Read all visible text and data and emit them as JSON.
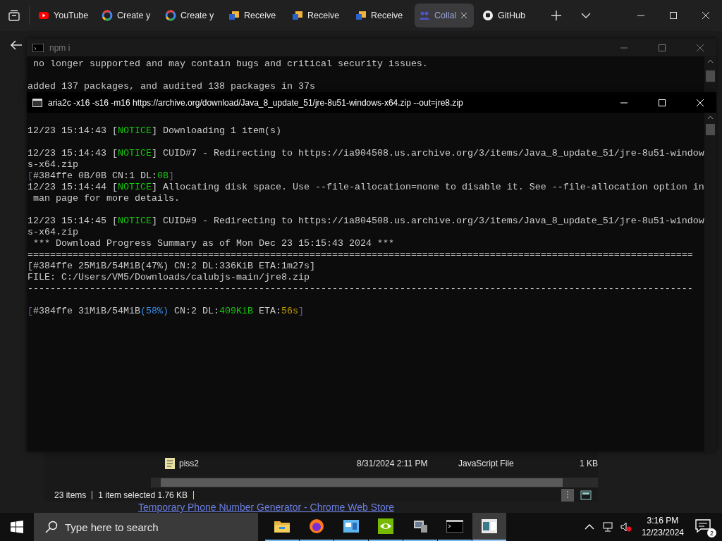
{
  "browser": {
    "tabs": [
      {
        "label": "YouTube",
        "kind": "video",
        "selected": false
      },
      {
        "label": "Create y",
        "kind": "search",
        "selected": false
      },
      {
        "label": "Create y",
        "kind": "search",
        "selected": false
      },
      {
        "label": "Receive",
        "kind": "mail",
        "selected": false
      },
      {
        "label": "Receive",
        "kind": "mail",
        "selected": false
      },
      {
        "label": "Receive",
        "kind": "mail",
        "selected": false
      },
      {
        "label": "Collal",
        "kind": "people",
        "selected": true
      },
      {
        "label": "GitHub",
        "kind": "code",
        "selected": false
      }
    ],
    "page_link": "Temporary Phone Number Generator - Chrome Web Store"
  },
  "npm_window": {
    "title": "npm i",
    "lines": [
      {
        "kind": "output",
        "segments": [
          {
            "kind": "text",
            "text": " no longer supported and may contain bugs and critical security issues."
          }
        ]
      },
      {
        "kind": "blank"
      },
      {
        "kind": "output",
        "segments": [
          {
            "kind": "text",
            "text": "added 137 packages, and audited 138 packages in 37s"
          }
        ]
      }
    ]
  },
  "aria_window": {
    "title": "aria2c  -x16 -s16 -m16 https://archive.org/download/Java_8_update_51/jre-8u51-windows-x64.zip --out=jre8.zip",
    "lines": [
      {
        "kind": "blank"
      },
      {
        "kind": "output",
        "segments": [
          {
            "kind": "text",
            "text": "12/23 15:14:43 ["
          },
          {
            "kind": "notice",
            "text": "NOTICE"
          },
          {
            "kind": "text",
            "text": "] Downloading 1 item(s)"
          }
        ]
      },
      {
        "kind": "blank"
      },
      {
        "kind": "output",
        "segments": [
          {
            "kind": "text",
            "text": "12/23 15:14:43 ["
          },
          {
            "kind": "notice",
            "text": "NOTICE"
          },
          {
            "kind": "text",
            "text": "] CUID#7 - Redirecting to https://ia904508.us.archive.org/3/items/Java_8_update_51/jre-8u51-window"
          }
        ]
      },
      {
        "kind": "output",
        "segments": [
          {
            "kind": "text",
            "text": "s-x64.zip"
          }
        ]
      },
      {
        "kind": "output",
        "segments": [
          {
            "kind": "dim",
            "text": "["
          },
          {
            "kind": "text",
            "text": "#384ffe 0B/0B CN:1 DL:"
          },
          {
            "kind": "notice",
            "text": "0B"
          },
          {
            "kind": "dim",
            "text": "]"
          }
        ]
      },
      {
        "kind": "output",
        "segments": [
          {
            "kind": "text",
            "text": "12/23 15:14:44 ["
          },
          {
            "kind": "notice",
            "text": "NOTICE"
          },
          {
            "kind": "text",
            "text": "] Allocating disk space. Use --file-allocation=none to disable it. See --file-allocation option in"
          }
        ]
      },
      {
        "kind": "output",
        "segments": [
          {
            "kind": "text",
            "text": " man page for more details."
          }
        ]
      },
      {
        "kind": "blank"
      },
      {
        "kind": "output",
        "segments": [
          {
            "kind": "text",
            "text": "12/23 15:14:45 ["
          },
          {
            "kind": "notice",
            "text": "NOTICE"
          },
          {
            "kind": "text",
            "text": "] CUID#9 - Redirecting to https://ia804508.us.archive.org/3/items/Java_8_update_51/jre-8u51-window"
          }
        ]
      },
      {
        "kind": "output",
        "segments": [
          {
            "kind": "text",
            "text": "s-x64.zip"
          }
        ]
      },
      {
        "kind": "output",
        "segments": [
          {
            "kind": "text",
            "text": " *** Download Progress Summary as of Mon Dec 23 15:15:43 2024 ***"
          }
        ]
      },
      {
        "kind": "output",
        "segments": [
          {
            "kind": "text",
            "text": "======================================================================================================================"
          }
        ]
      },
      {
        "kind": "output",
        "segments": [
          {
            "kind": "text",
            "text": "[#384ffe 25MiB/54MiB(47%) CN:2 DL:336KiB ETA:1m27s]"
          }
        ]
      },
      {
        "kind": "output",
        "segments": [
          {
            "kind": "text",
            "text": "FILE: C:/Users/VM5/Downloads/calubjs-main/jre8.zip"
          }
        ]
      },
      {
        "kind": "output",
        "segments": [
          {
            "kind": "text",
            "text": "----------------------------------------------------------------------------------------------------------------------"
          }
        ]
      },
      {
        "kind": "blank"
      },
      {
        "kind": "output",
        "segments": [
          {
            "kind": "dim",
            "text": "["
          },
          {
            "kind": "text",
            "text": "#384ffe 31MiB/54MiB"
          },
          {
            "kind": "percent",
            "text": "(58%)"
          },
          {
            "kind": "text",
            "text": " CN:2 DL:"
          },
          {
            "kind": "notice",
            "text": "409KiB"
          },
          {
            "kind": "text",
            "text": " ETA:"
          },
          {
            "kind": "eta",
            "text": "56s"
          },
          {
            "kind": "dim",
            "text": "]"
          }
        ]
      }
    ]
  },
  "explorer": {
    "rows": [
      {
        "name": "piss2",
        "modified": "8/31/2024 2:11 PM",
        "type": "JavaScript File",
        "size": "1 KB"
      }
    ],
    "status": {
      "count": "23 items",
      "selection": "1 item selected  1.76 KB"
    }
  },
  "taskbar": {
    "search_placeholder": "Type here to search",
    "apps": [
      {
        "kind": "folder",
        "selected": false
      },
      {
        "kind": "browser",
        "selected": false
      },
      {
        "kind": "window",
        "selected": false
      },
      {
        "kind": "gpu",
        "selected": false
      },
      {
        "kind": "computer",
        "selected": false
      },
      {
        "kind": "console",
        "selected": false
      },
      {
        "kind": "notepad",
        "selected": true
      }
    ],
    "time": "3:16 PM",
    "date": "12/23/2024",
    "notifications": "2"
  }
}
